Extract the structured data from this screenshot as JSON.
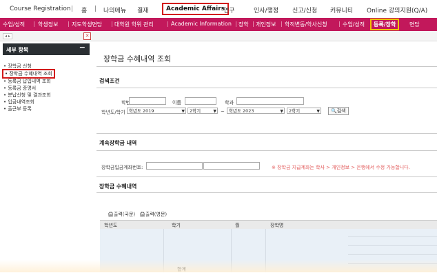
{
  "top_nav": {
    "items": [
      "Course Registration",
      "홈",
      "나의메뉴",
      "결재",
      "Academic Affairs",
      "연구",
      "인사/행정",
      "신고/신청",
      "커뮤니티",
      "Online 강의지원(Q/A)"
    ],
    "active_index": 4
  },
  "sub_nav": {
    "items": [
      "수업/성적",
      "학생정보",
      "지도학생면담",
      "대학원 학위 관리",
      "Academic Information",
      "장학",
      "개인정보",
      "학적변동/학사신청",
      "수업/성적",
      "등록/장학",
      "면담"
    ],
    "active_index": 9
  },
  "tab_bar": {
    "prev_next": "◂ ▸",
    "close_symbol": "✕"
  },
  "sidebar": {
    "title": "세부 항목",
    "collapse_symbol": "−",
    "items": [
      "장학금 신청",
      "장학금 수혜내역 조회",
      "등록금 납입내역 조회",
      "등록금 증명서",
      "분납신청 및 결과조회",
      "입금내역조회",
      "출근부 등록"
    ],
    "active_index": 1
  },
  "main": {
    "page_title": "장학금 수혜내역 조회",
    "search_section_title": "검색조건",
    "search": {
      "student_id_label": "학번",
      "name_label": "이름",
      "department_label": "학과",
      "term_label": "학년도/학기",
      "year_from": "학년도 2019",
      "semester_from": "2학기",
      "range_sep": "~",
      "year_to": "학년도 2023",
      "semester_to": "2학기",
      "search_button": "검색"
    },
    "account_section_title": "계속장학금 내역",
    "account": {
      "label": "장학금입금계좌번호:",
      "notice": "※ 장학금 지급계좌는 학사 > 개인정보 > 은행에서 수정 가능합니다."
    },
    "history_section_title": "장학금 수혜내역",
    "print_korean": "출력(국문)",
    "print_english": "출력(영문)",
    "columns": [
      "학년도",
      "학기",
      "월",
      "장학명"
    ],
    "total_label": "합계"
  },
  "colors": {
    "sub_nav_bg": "#c2185b",
    "top_active_border": "#d21b1b",
    "sub_active_border": "#f0c400",
    "notice_text": "#e25a5a",
    "grid_bg": "#e9f0f7"
  }
}
